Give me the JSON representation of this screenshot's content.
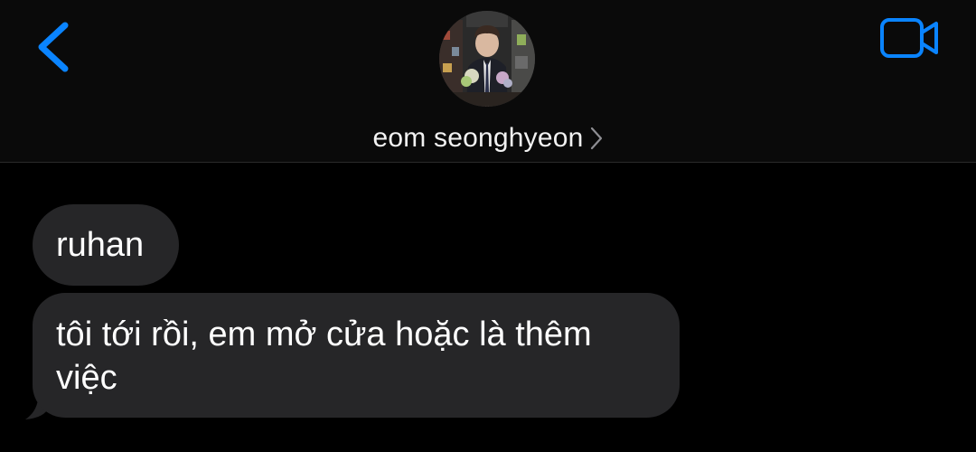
{
  "header": {
    "contact_name": "eom seonghyeon",
    "back_icon": "chevron-left-icon",
    "video_icon": "video-camera-icon",
    "accent_color": "#0a84ff"
  },
  "messages": [
    {
      "direction": "received",
      "text": "ruhan"
    },
    {
      "direction": "received",
      "text": "tôi tới rồi, em mở cửa hoặc là thêm việc"
    }
  ],
  "colors": {
    "background": "#000000",
    "bubble_received": "#262628",
    "text": "#ffffff"
  }
}
